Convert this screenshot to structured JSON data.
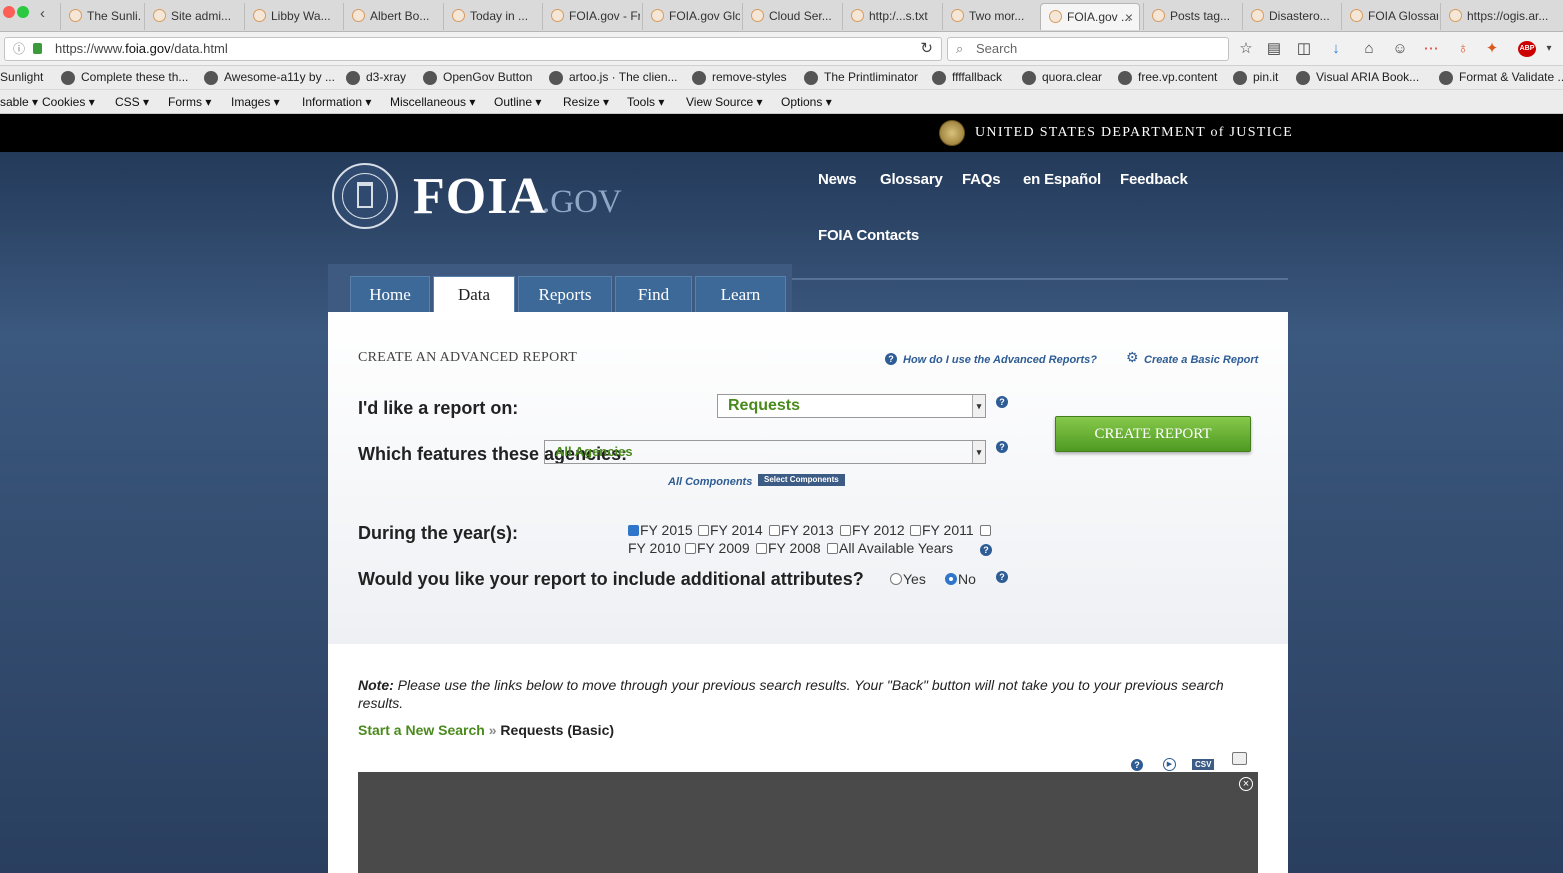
{
  "browser": {
    "tabs": [
      {
        "label": "The Sunli..."
      },
      {
        "label": "Site admi..."
      },
      {
        "label": "Libby Wa..."
      },
      {
        "label": "Albert Bo..."
      },
      {
        "label": "Today in ..."
      },
      {
        "label": "FOIA.gov - Fr..."
      },
      {
        "label": "FOIA.gov Glo..."
      },
      {
        "label": "Cloud Ser..."
      },
      {
        "label": "http:/...s.txt"
      },
      {
        "label": "Two mor..."
      },
      {
        "label": "FOIA.gov ..."
      },
      {
        "label": "Posts tag..."
      },
      {
        "label": "Disastero..."
      },
      {
        "label": "FOIA Glossary"
      },
      {
        "label": "https://ogis.ar..."
      }
    ],
    "url_prefix": "https://www.",
    "url_domain": "foia.gov",
    "url_path": "/data.html",
    "search_placeholder": "Search",
    "bookmarks": [
      {
        "label": "Sunlight"
      },
      {
        "label": "Complete these th..."
      },
      {
        "label": "Awesome-a11y by ..."
      },
      {
        "label": "d3-xray"
      },
      {
        "label": "OpenGov Button"
      },
      {
        "label": "artoo.js · The clien..."
      },
      {
        "label": "remove-styles"
      },
      {
        "label": "The Printliminator"
      },
      {
        "label": "ffffallback"
      },
      {
        "label": "quora.clear"
      },
      {
        "label": "free.vp.content"
      },
      {
        "label": "pin.it"
      },
      {
        "label": "Visual ARIA Book..."
      },
      {
        "label": "Format & Validate ..."
      }
    ],
    "devtools": [
      {
        "label": "sable ▾"
      },
      {
        "label": "Cookies ▾"
      },
      {
        "label": "CSS ▾"
      },
      {
        "label": "Forms ▾"
      },
      {
        "label": "Images ▾"
      },
      {
        "label": "Information ▾"
      },
      {
        "label": "Miscellaneous ▾"
      },
      {
        "label": "Outline ▾"
      },
      {
        "label": "Resize ▾"
      },
      {
        "label": "Tools ▾"
      },
      {
        "label": "View Source ▾"
      },
      {
        "label": "Options ▾"
      }
    ]
  },
  "site": {
    "doj_banner": "UNITED STATES DEPARTMENT of JUSTICE",
    "logo_main": "FOIA",
    "logo_suffix": ".GOV",
    "top_nav": [
      "News",
      "Glossary",
      "FAQs",
      "en Español",
      "Feedback",
      "FOIA Contacts"
    ],
    "section_tabs": [
      "Home",
      "Data",
      "Reports",
      "Find",
      "Learn"
    ],
    "active_tab": "Data",
    "form": {
      "heading": "CREATE AN ADVANCED REPORT",
      "help_link": "How do I use the Advanced Reports?",
      "basic_link": "Create a Basic Report",
      "q_report_on": "I'd like a report on:",
      "report_on_value": "Requests",
      "q_agencies": "Which features these agencies:",
      "agencies_value": "All Agencies",
      "all_components": "All Components",
      "select_components": "Select Components",
      "create_button": "CREATE REPORT",
      "q_years": "During the year(s):",
      "years": [
        {
          "label": "FY 2015",
          "checked": true
        },
        {
          "label": "FY 2014",
          "checked": false
        },
        {
          "label": "FY 2013",
          "checked": false
        },
        {
          "label": "FY 2012",
          "checked": false
        },
        {
          "label": "FY 2011",
          "checked": false
        },
        {
          "label": "FY 2010",
          "checked": false
        },
        {
          "label": "FY 2009",
          "checked": false
        },
        {
          "label": "FY 2008",
          "checked": false
        },
        {
          "label": "All Available Years",
          "checked": false
        }
      ],
      "q_attributes": "Would you like your report to include additional attributes?",
      "yes_label": "Yes",
      "no_label": "No",
      "selected_attribute": "No"
    },
    "note_label": "Note:",
    "note_text": "Please use the links below to move through your previous search results. Your \"Back\" button will not take you to your previous search results.",
    "crumb_link": "Start a New Search",
    "crumb_sep": "»",
    "crumb_current": "Requests (Basic)",
    "csv_label": "CSV",
    "colors": {
      "green": "#4a8a1c",
      "link_blue": "#2e5c94",
      "banner": "#000000"
    }
  }
}
